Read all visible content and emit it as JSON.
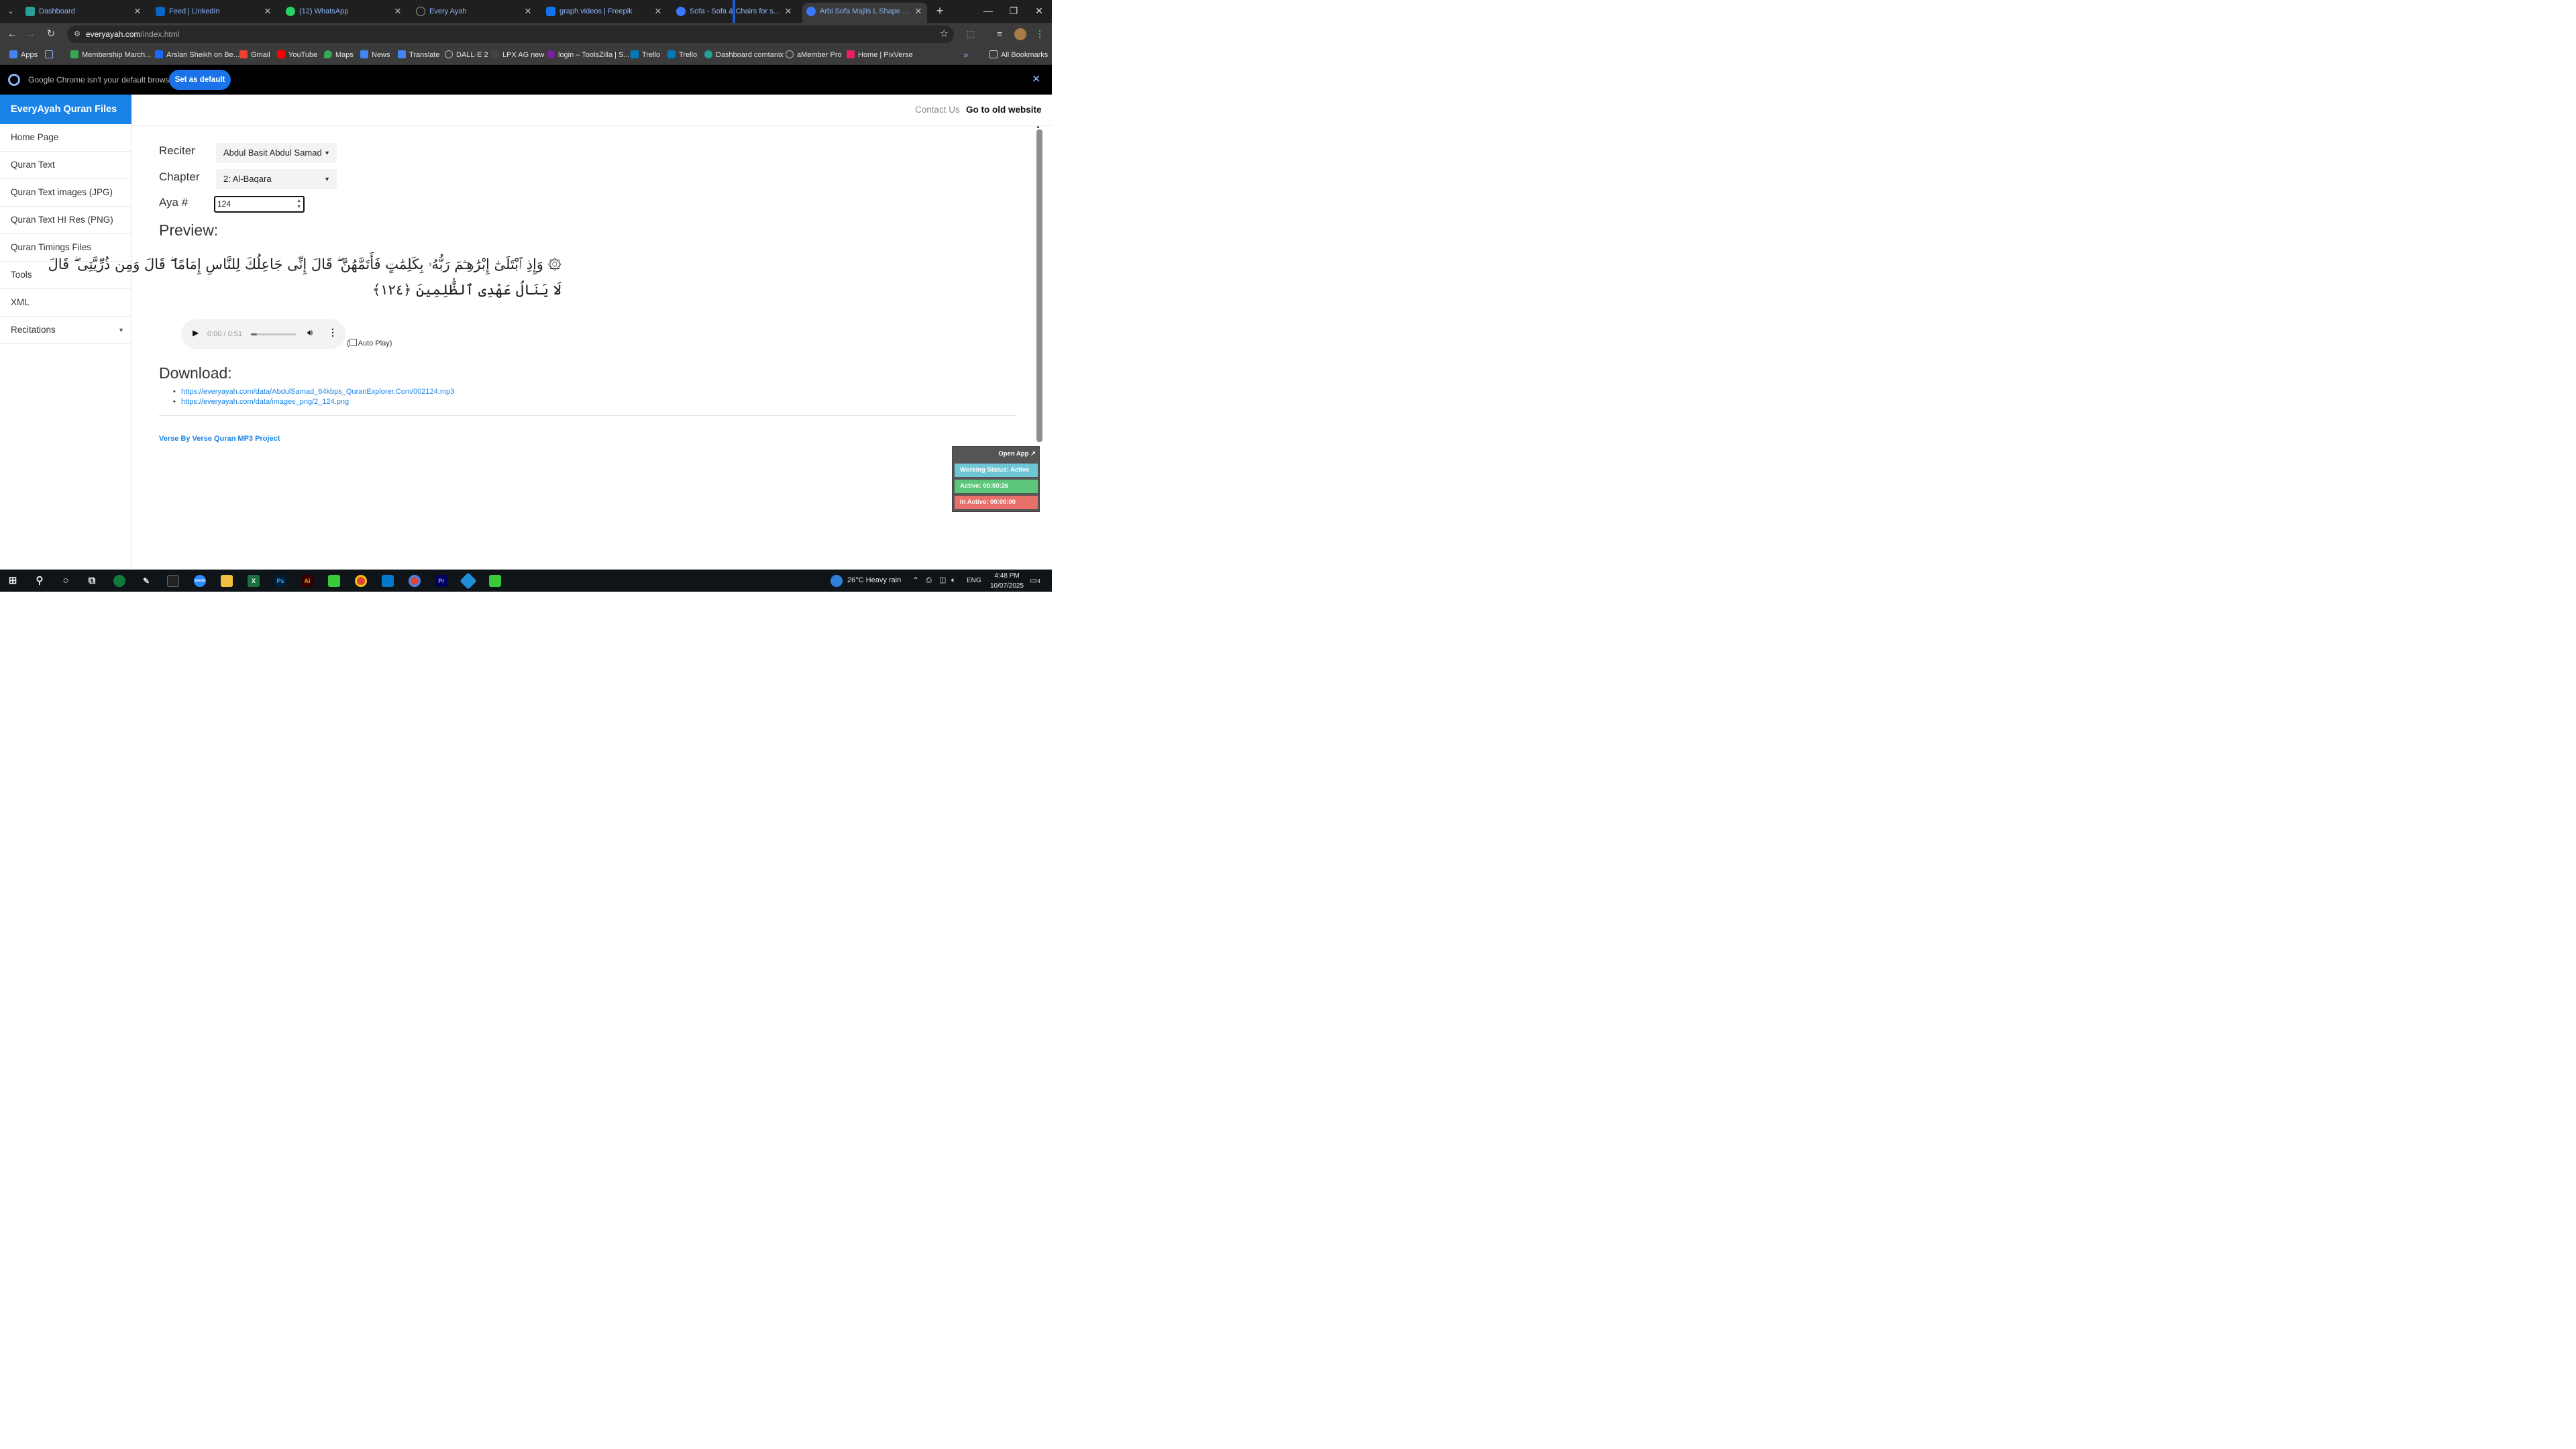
{
  "browser": {
    "tabs": [
      {
        "title": "Dashboard",
        "fav_color": "#2aa198",
        "left": 0
      },
      {
        "title": "Feed | LinkedIn",
        "fav_color": "#0a66c2"
      },
      {
        "title": "(12) WhatsApp",
        "fav_color": "#25d366"
      },
      {
        "title": "Every Ayah",
        "fav_color": "#888888"
      },
      {
        "title": "graph videos | Freepik",
        "fav_color": "#1273eb"
      },
      {
        "title": "Sofa - Sofa & Chairs for sale in",
        "fav_color": "#3a77ff"
      },
      {
        "title": "Arbi Sofa Majlis L Shape Sofa -",
        "fav_color": "#3a77ff"
      }
    ],
    "url_host": "everyayah.com",
    "url_path": "/index.html",
    "bookmarks": [
      {
        "label": "Apps",
        "color": "#4285f4"
      },
      {
        "label": "",
        "color": "#8ab4f8"
      },
      {
        "label": "Membership March...",
        "color": "#34a853"
      },
      {
        "label": "Arslan Sheikh on Be...",
        "color": "#1769ff"
      },
      {
        "label": "Gmail",
        "color": "#ea4335"
      },
      {
        "label": "YouTube",
        "color": "#ff0000"
      },
      {
        "label": "Maps",
        "color": "#34a853"
      },
      {
        "label": "News",
        "color": "#4285f4"
      },
      {
        "label": "Translate",
        "color": "#4285f4"
      },
      {
        "label": "DALL·E 2",
        "color": "#9e9e9e"
      },
      {
        "label": "LPX AG new",
        "color": "#444444"
      },
      {
        "label": "login – ToolsZilla | S...",
        "color": "#7b1fa2"
      },
      {
        "label": "Trello",
        "color": "#0079bf"
      },
      {
        "label": "Trello",
        "color": "#0079bf"
      },
      {
        "label": "Dashboard comtanix",
        "color": "#2aa198"
      },
      {
        "label": "aMember Pro",
        "color": "#9e9e9e"
      },
      {
        "label": "Home | PixVerse",
        "color": "#e91e63"
      }
    ],
    "all_bookmarks": "All Bookmarks",
    "infobar_message": "Google Chrome isn't your default browser",
    "infobar_button": "Set as default"
  },
  "site": {
    "brand": "EveryAyah Quran Files",
    "nav_contact": "Contact Us",
    "nav_old": "Go to old website",
    "sidebar": [
      {
        "label": "Home Page"
      },
      {
        "label": "Quran Text"
      },
      {
        "label": "Quran Text images (JPG)"
      },
      {
        "label": "Quran Text HI Res (PNG)"
      },
      {
        "label": "Quran Timings Files"
      },
      {
        "label": "Tools"
      },
      {
        "label": "XML"
      },
      {
        "label": "Recitations"
      }
    ]
  },
  "form": {
    "reciter_label": "Reciter",
    "reciter_value": "Abdul Basit Abdul Samad",
    "chapter_label": "Chapter",
    "chapter_value": "2: Al-Baqara",
    "aya_label": "Aya #",
    "aya_value": "124"
  },
  "preview": {
    "heading": "Preview:",
    "ayah_line1": "۞ وَإِذِ ٱبْتَلَىٰٓ إِبْرَٰهِـۧمَ رَبُّهُۥ بِكَلِمَٰتٍ فَأَتَمَّهُنَّ ۖ قَالَ إِنِّى جَاعِلُكَ لِلنَّاسِ إِمَامًا ۖ قَالَ وَمِن ذُرِّيَّتِى ۖ قَالَ",
    "ayah_line2": "لَا يَنَالُ عَهْدِى ٱلظَّٰلِمِينَ ﴿١٢٤﴾",
    "audio_time": "0:00 / 0:51",
    "audio_progress": 0.14,
    "autoplay_label": "Auto Play)"
  },
  "download": {
    "heading": "Download:",
    "links": [
      "https://everyayah.com/data/AbdulSamad_64kbps_QuranExplorer.Com/002124.mp3",
      "https://everyayah.com/data/images_png/2_124.png"
    ],
    "footer": "Verse By Verse Quran MP3 Project"
  },
  "widget": {
    "open_app": "Open App ↗",
    "status": "Working Status: Active",
    "active": "Active: 00:50:26",
    "inactive": "In Active: 00:00:00",
    "colors": {
      "status": "#6fc7d6",
      "active": "#5cc77a",
      "inactive": "#e8706a"
    }
  },
  "taskbar": {
    "weather": "26°C  Heavy rain",
    "lang": "ENG",
    "time": "4:48 PM",
    "date": "10/07/2025",
    "notif_count": "4"
  }
}
